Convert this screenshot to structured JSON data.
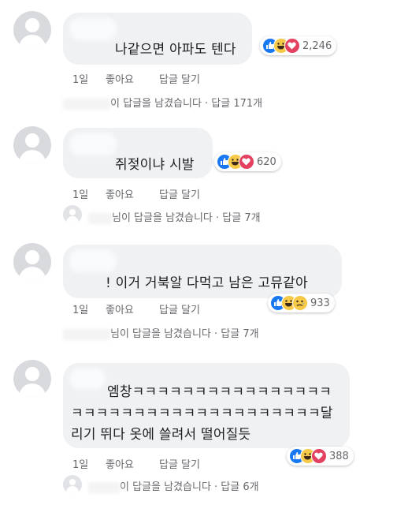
{
  "comments": [
    {
      "text": "나같으면 아파도 텐다",
      "reactions": [
        "like",
        "haha",
        "love"
      ],
      "reaction_count": "2,246",
      "time": "1일",
      "like": "좋아요",
      "reply": "답글 달기",
      "replies_text": "이 답글을 남겼습니다 · 답글 171개"
    },
    {
      "text": "쥐젖이냐 시발",
      "reactions": [
        "like",
        "haha",
        "love"
      ],
      "reaction_count": "620",
      "time": "1일",
      "like": "좋아요",
      "reply": "답글 달기",
      "replies_text": "님이 답글을 남겼습니다 · 답글 7개"
    },
    {
      "text": "! 이거 거북알 다먹고 남은 고뮤같아",
      "reactions": [
        "like",
        "haha",
        "sad"
      ],
      "reaction_count": "933",
      "time": "1일",
      "like": "좋아요",
      "reply": "답글 달기",
      "replies_text": "님이 답글을 남겼습니다 · 답글 7개"
    },
    {
      "text": "엠창ㅋㅋㅋㅋㅋㅋㅋㅋㅋㅋㅋㅋㅋㅋㅋㅋㅋㅋㅋㅋㅋㅋㅋㅋㅋㅋㅋㅋㅋㅋㅋㅋㅋㅋㅋㅋ달리기 뛰다 옷에 쓸려서 떨어질듯",
      "reactions": [
        "like",
        "haha",
        "love"
      ],
      "reaction_count": "388",
      "time": "1일",
      "like": "좋아요",
      "reply": "답글 달기",
      "replies_text": "이 답글을 남겼습니다 · 답글 6개"
    }
  ]
}
